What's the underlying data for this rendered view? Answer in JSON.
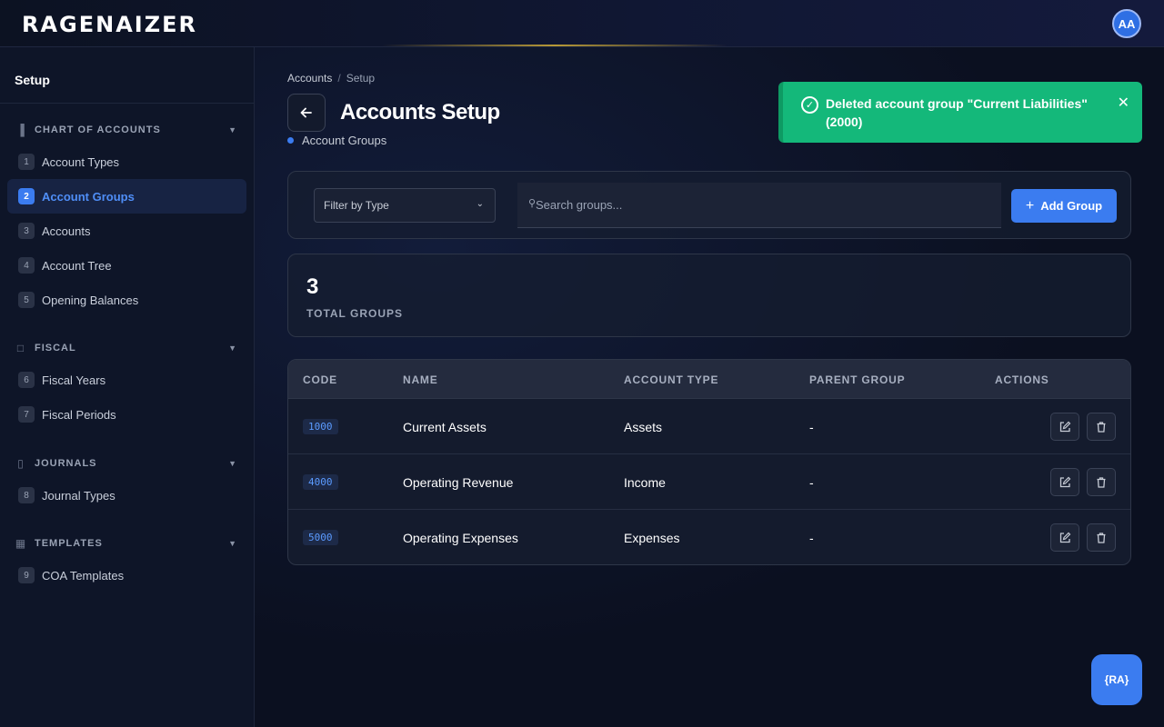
{
  "app": {
    "logo": "RAGENAIZER",
    "avatar_initials": "AA"
  },
  "sidebar": {
    "title": "Setup",
    "sections": [
      {
        "label": "CHART OF ACCOUNTS",
        "icon": "bar-chart-icon",
        "items": [
          {
            "num": "1",
            "label": "Account Types"
          },
          {
            "num": "2",
            "label": "Account Groups",
            "active": true
          },
          {
            "num": "3",
            "label": "Accounts"
          },
          {
            "num": "4",
            "label": "Account Tree"
          },
          {
            "num": "5",
            "label": "Opening Balances"
          }
        ]
      },
      {
        "label": "FISCAL",
        "icon": "calendar-icon",
        "items": [
          {
            "num": "6",
            "label": "Fiscal Years"
          },
          {
            "num": "7",
            "label": "Fiscal Periods"
          }
        ]
      },
      {
        "label": "JOURNALS",
        "icon": "book-icon",
        "items": [
          {
            "num": "8",
            "label": "Journal Types"
          }
        ]
      },
      {
        "label": "TEMPLATES",
        "icon": "template-icon",
        "items": [
          {
            "num": "9",
            "label": "COA Templates"
          }
        ]
      }
    ]
  },
  "header": {
    "breadcrumb": [
      "Accounts",
      "Setup"
    ],
    "title": "Accounts Setup",
    "subtitle": "Account Groups"
  },
  "toast": {
    "message": "Deleted account group \"Current Liabilities\" (2000)",
    "color": "#14b87a"
  },
  "filters": {
    "type_select": "Filter by Type",
    "search_placeholder": "Search groups...",
    "add_label": "Add Group"
  },
  "stats": {
    "value": "3",
    "label": "TOTAL GROUPS"
  },
  "table": {
    "columns": [
      "CODE",
      "NAME",
      "ACCOUNT TYPE",
      "PARENT GROUP",
      "ACTIONS"
    ],
    "rows": [
      {
        "code": "1000",
        "name": "Current Assets",
        "type": "Assets",
        "parent": "-"
      },
      {
        "code": "4000",
        "name": "Operating Revenue",
        "type": "Income",
        "parent": "-"
      },
      {
        "code": "5000",
        "name": "Operating Expenses",
        "type": "Expenses",
        "parent": "-"
      }
    ]
  },
  "fab": {
    "label": "{RA}"
  },
  "colors": {
    "accent": "#3b7cf0",
    "success": "#14b87a",
    "background": "#0b1020"
  }
}
